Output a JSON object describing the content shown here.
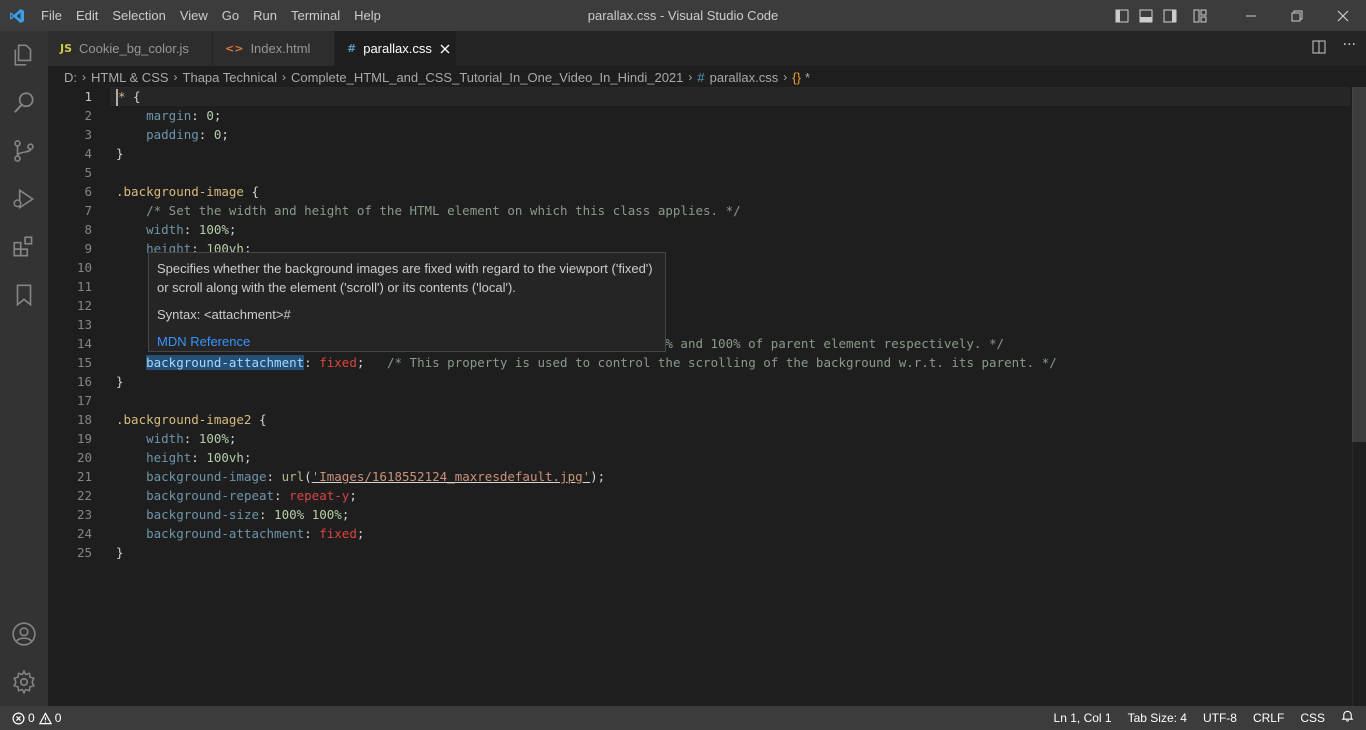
{
  "window": {
    "title": "parallax.css - Visual Studio Code",
    "menu": [
      "File",
      "Edit",
      "Selection",
      "View",
      "Go",
      "Run",
      "Terminal",
      "Help"
    ]
  },
  "tabs": [
    {
      "icon": "JS",
      "label": "Cookie_bg_color.js",
      "active": false,
      "icon_color": "#cbcb41"
    },
    {
      "icon": "<>",
      "label": "Index.html",
      "active": false,
      "icon_color": "#e37933"
    },
    {
      "icon": "#",
      "label": "parallax.css",
      "active": true,
      "icon_color": "#519aba"
    }
  ],
  "breadcrumb": {
    "parts": [
      "D:",
      "HTML & CSS",
      "Thapa Technical",
      "Complete_HTML_and_CSS_Tutorial_In_One_Video_In_Hindi_2021"
    ],
    "file": "parallax.css",
    "symbol": "*"
  },
  "editor": {
    "line_numbers": [
      "1",
      "2",
      "3",
      "4",
      "5",
      "6",
      "7",
      "8",
      "9",
      "10",
      "11",
      "12",
      "13",
      "14",
      "15",
      "16",
      "17",
      "18",
      "19",
      "20",
      "21",
      "22",
      "23",
      "24",
      "25"
    ],
    "lines": {
      "l1_sel": "*",
      "l1_rest": " {",
      "l2_prop": "margin",
      "l2_val": "0",
      "l3_prop": "padding",
      "l3_val": "0",
      "l4": "}",
      "l6_sel": ".background-image",
      "l7_cmt": "/* Set the width and height of the HTML element on which this class applies. */",
      "l8_prop": "width",
      "l8_num": "100",
      "l8_unit": "%",
      "l9_prop": "height",
      "l9_num": "100",
      "l9_unit": "vh",
      "l14_tail": "o 100% and 100% of parent element respectively. */",
      "l15_prop": "background-attachment",
      "l15_val": "fixed",
      "l15_cmt": "/* This property is used to control the scrolling of the background w.r.t. its parent. */",
      "l16": "}",
      "l18_sel": ".background-image2",
      "l19_prop": "width",
      "l19_num": "100",
      "l19_unit": "%",
      "l20_prop": "height",
      "l20_num": "100",
      "l20_unit": "vh",
      "l21_prop": "background-image",
      "l21_fn": "url",
      "l21_str": "'Images/1618552124_maxresdefault.jpg'",
      "l22_prop": "background-repeat",
      "l22_val": "repeat-y",
      "l23_prop": "background-size",
      "l23_v1": "100",
      "l23_v2": "100",
      "l23_unit": "%",
      "l24_prop": "background-attachment",
      "l24_val": "fixed",
      "l25": "}"
    }
  },
  "hover": {
    "description": "Specifies whether the background images are fixed with regard to the viewport ('fixed') or scroll along with the element ('scroll') or its contents ('local').",
    "syntax": "Syntax: <attachment>#",
    "link": "MDN Reference"
  },
  "status": {
    "errors": "0",
    "warnings": "0",
    "position": "Ln 1, Col 1",
    "tab_size": "Tab Size: 4",
    "encoding": "UTF-8",
    "eol": "CRLF",
    "language": "CSS"
  },
  "colors": {
    "accent": "#007acc",
    "selector": "#d7ba7d",
    "property": "#9cdcfe",
    "number": "#b5cea8",
    "comment": "#6a9955",
    "string": "#ce9178"
  }
}
